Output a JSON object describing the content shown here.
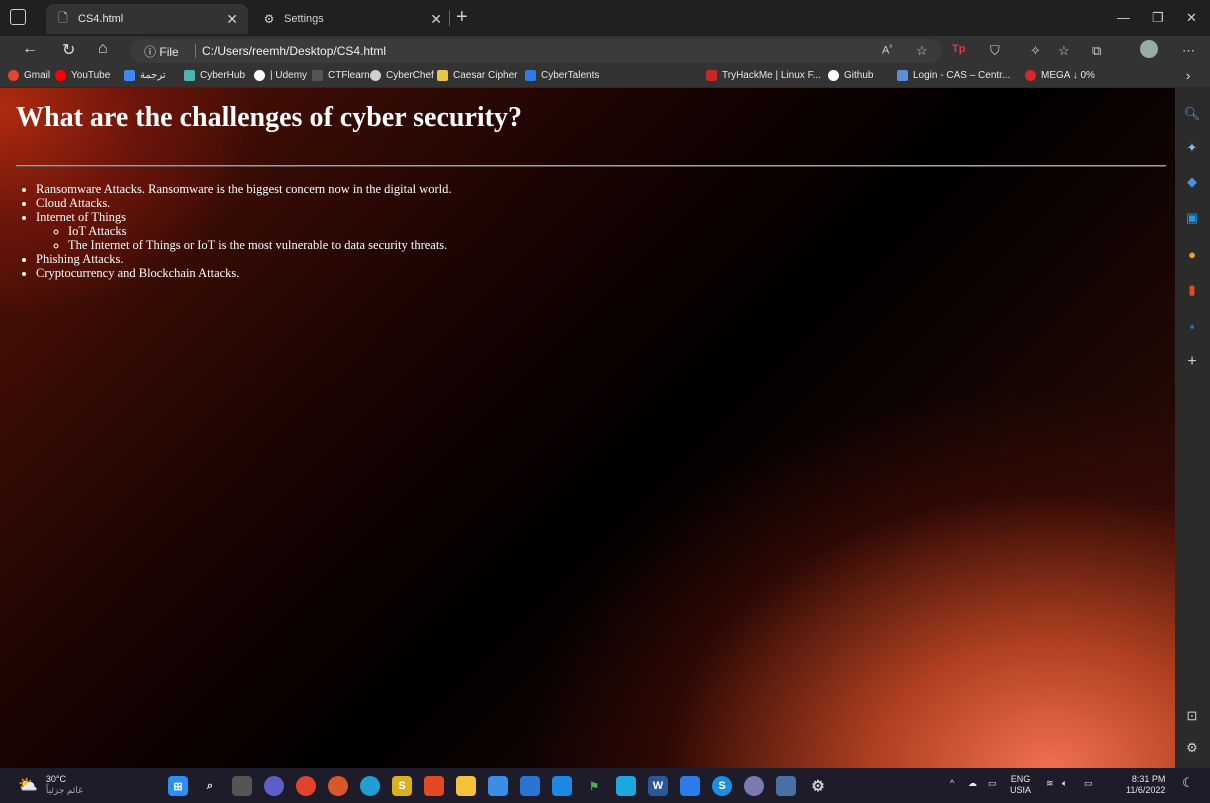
{
  "browser": {
    "tabs": [
      {
        "title": "CS4.html",
        "active": true
      },
      {
        "title": "Settings",
        "active": false
      }
    ],
    "address_prefix": "File",
    "url": "C:/Users/reemh/Desktop/CS4.html"
  },
  "favorites": [
    {
      "label": "Gmail",
      "icon_color": "#e8e8e8"
    },
    {
      "label": "YouTube",
      "icon_color": "#ff0000"
    },
    {
      "label": "ترجمة",
      "icon_color": "#4285f4"
    },
    {
      "label": "CyberHub",
      "icon_color": "#4db6ac"
    },
    {
      "label": "| Udemy",
      "icon_color": "#ffffff"
    },
    {
      "label": "CTFlearn",
      "icon_color": "#555555"
    },
    {
      "label": "CyberChef",
      "icon_color": "#cfcfcf"
    },
    {
      "label": "Caesar Cipher",
      "icon_color": "#e6c74a"
    },
    {
      "label": "CyberTalents",
      "icon_color": "#2b7de9"
    },
    {
      "label": "TryHackMe | Linux F...",
      "icon_color": "#c62828"
    },
    {
      "label": "Github",
      "icon_color": "#ffffff"
    },
    {
      "label": "Login - CAS – Centr...",
      "icon_color": "#5c8fd6"
    },
    {
      "label": "MEGA ↓ 0%",
      "icon_color": "#d9272e"
    }
  ],
  "page": {
    "title": "What are the challenges of cyber security?",
    "items": [
      "Ransomware Attacks. Ransomware is the biggest concern now in the digital world.",
      "Cloud Attacks.",
      "Internet of Things",
      "Phishing Attacks.",
      "Cryptocurrency and Blockchain Attacks."
    ],
    "subitems": [
      "IoT Attacks",
      "The Internet of Things or IoT is the most vulnerable to data security threats."
    ]
  },
  "taskbar": {
    "temperature": "30°C",
    "weather_text": "غائم جزئياً",
    "language": "ENG",
    "region": "USIA",
    "time": "8:31 PM",
    "date": "11/6/2022"
  }
}
